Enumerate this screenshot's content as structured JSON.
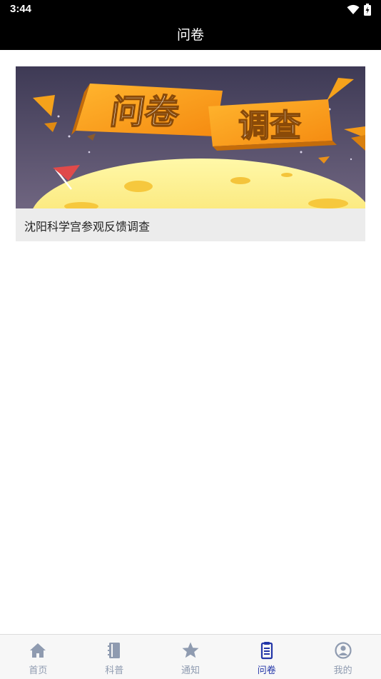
{
  "status_bar": {
    "time": "3:44",
    "icons": [
      "wifi-icon",
      "battery-charging-icon"
    ]
  },
  "header": {
    "title": "问卷"
  },
  "survey_list": [
    {
      "banner_lettering": [
        "问卷",
        "调查"
      ],
      "title": "沈阳科学宫参观反馈调查"
    }
  ],
  "tab_bar": {
    "active_color": "#2336a8",
    "inactive_color": "#8f9bb0",
    "items": [
      {
        "label": "首页",
        "icon": "home-icon",
        "active": false
      },
      {
        "label": "科普",
        "icon": "book-icon",
        "active": false
      },
      {
        "label": "通知",
        "icon": "star-icon",
        "active": false
      },
      {
        "label": "问卷",
        "icon": "clipboard-icon",
        "active": true
      },
      {
        "label": "我的",
        "icon": "user-circle-icon",
        "active": false
      }
    ]
  }
}
